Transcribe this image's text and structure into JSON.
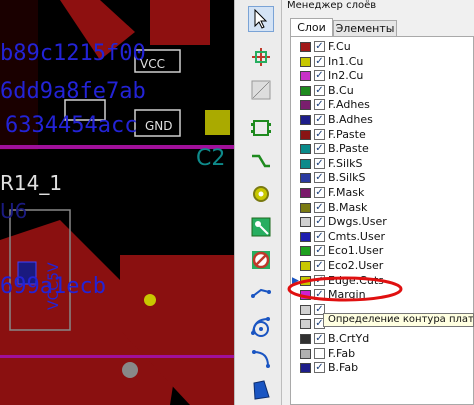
{
  "panel": {
    "title": "Менеджер слоёв",
    "tabs": [
      "Слои",
      "Элементы"
    ]
  },
  "layers": [
    {
      "name": "F.Cu",
      "color": "#a11a1a",
      "checked": true
    },
    {
      "name": "In1.Cu",
      "color": "#c8c800",
      "checked": true
    },
    {
      "name": "In2.Cu",
      "color": "#c832c8",
      "checked": true
    },
    {
      "name": "B.Cu",
      "color": "#1e8a1e",
      "checked": true
    },
    {
      "name": "F.Adhes",
      "color": "#7a1e6e",
      "checked": true
    },
    {
      "name": "B.Adhes",
      "color": "#1e1e8a",
      "checked": true
    },
    {
      "name": "F.Paste",
      "color": "#8a1414",
      "checked": true
    },
    {
      "name": "B.Paste",
      "color": "#0a8a8a",
      "checked": true
    },
    {
      "name": "F.SilkS",
      "color": "#0e8a8a",
      "checked": true
    },
    {
      "name": "B.SilkS",
      "color": "#2a3aa0",
      "checked": true
    },
    {
      "name": "F.Mask",
      "color": "#7a1a6a",
      "checked": true
    },
    {
      "name": "B.Mask",
      "color": "#7a7a12",
      "checked": true
    },
    {
      "name": "Dwgs.User",
      "color": "#d0d0d0",
      "checked": true
    },
    {
      "name": "Cmts.User",
      "color": "#1e1eb0",
      "checked": true
    },
    {
      "name": "Eco1.User",
      "color": "#1ea01e",
      "checked": true
    },
    {
      "name": "Eco2.User",
      "color": "#c8c800",
      "checked": true
    },
    {
      "name": "Edge.Cuts",
      "color": "#c8c800",
      "checked": true,
      "selected": true
    },
    {
      "name": "Margin",
      "color": "#d020d0",
      "checked": true
    },
    {
      "name": "",
      "color": "#d0d0d0",
      "checked": true
    },
    {
      "name": "",
      "color": "#d0d0d0",
      "checked": true
    },
    {
      "name": "B.CrtYd",
      "color": "#303030",
      "checked": true
    },
    {
      "name": "F.Fab",
      "color": "#b0b0b0",
      "checked": false
    },
    {
      "name": "B.Fab",
      "color": "#1e1e8a",
      "checked": true
    }
  ],
  "tooltip": "Определение контура платы",
  "canvas_text": {
    "ref1": "R14_1",
    "ref2": "U6",
    "net_hex1": "b89c1215f00",
    "net_hex2": "6dd9a8fe7ab",
    "net_hex3": "6334454acc",
    "net_hex4": "699a1ecb",
    "pad_vcc": "VCC",
    "pad_gnd": "GND",
    "c2": "C2",
    "vcc5v": "VCC5V"
  },
  "tools": [
    "select-tool",
    "highlight-net-tool",
    "local-ratsnest-tool",
    "add-footprint-tool",
    "route-track-tool",
    "add-via-tool",
    "add-zone-tool",
    "add-keepout-tool",
    "draw-line-tool",
    "draw-arc-tool",
    "draw-circle-tool",
    "draw-curve-tool",
    "draw-polygon-tool"
  ]
}
